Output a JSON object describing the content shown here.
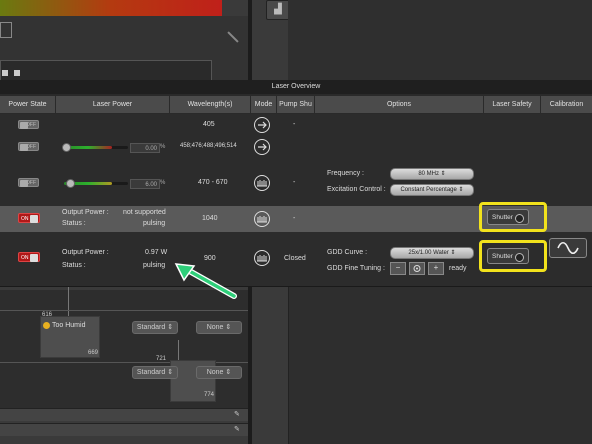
{
  "window": {
    "title": "Laser Overview"
  },
  "columns": [
    "Power State",
    "Laser Power",
    "Wavelength(s)",
    "Mode",
    "Pump Shu",
    "Options",
    "Laser Safety",
    "Calibration"
  ],
  "rows": [
    {
      "state": "OFF",
      "wavelength": "405",
      "pump": "-"
    },
    {
      "state": "OFF",
      "power_pct": "0.00",
      "pct_sign": "%",
      "power_level": 0.0,
      "wavelength": "458;476;488;496;514"
    },
    {
      "state": "OFF",
      "power_pct": "6.00",
      "pct_sign": "%",
      "power_level": 0.06,
      "wavelength": "470 - 670",
      "pump": "-",
      "frequency_label": "Frequency :",
      "frequency_value": "80 MHz",
      "excitation_label": "Excitation Control :",
      "excitation_value": "Constant Percentage"
    },
    {
      "state": "ON",
      "output_label": "Output Power :",
      "output_value": "not supported",
      "status_label": "Status :",
      "status_value": "pulsing",
      "wavelength": "1040",
      "pump": "-",
      "shutter_label": "Shutter"
    },
    {
      "state": "ON",
      "output_label": "Output Power :",
      "output_value": "0.97 W",
      "status_label": "Status :",
      "status_value": "pulsing",
      "wavelength": "900",
      "pump": "Closed",
      "gdd_curve_label": "GDD Curve :",
      "gdd_curve_value": "25x/1.00 Water",
      "gdd_tuning_label": "GDD Fine Tuning :",
      "gdd_minus": "−",
      "gdd_plus": "+",
      "gdd_status": "ready",
      "shutter_label": "Shutter"
    }
  ],
  "background": {
    "too_humid": "Too Humid",
    "standard_1": "Standard",
    "none_1": "None",
    "standard_2": "Standard",
    "none_2": "None",
    "node_616": "616",
    "node_669": "669",
    "node_721": "721",
    "node_774": "774"
  },
  "colors": {
    "highlight": "#f2e21c",
    "arrow": "#2fcf7a",
    "on_red": "#b01818"
  }
}
